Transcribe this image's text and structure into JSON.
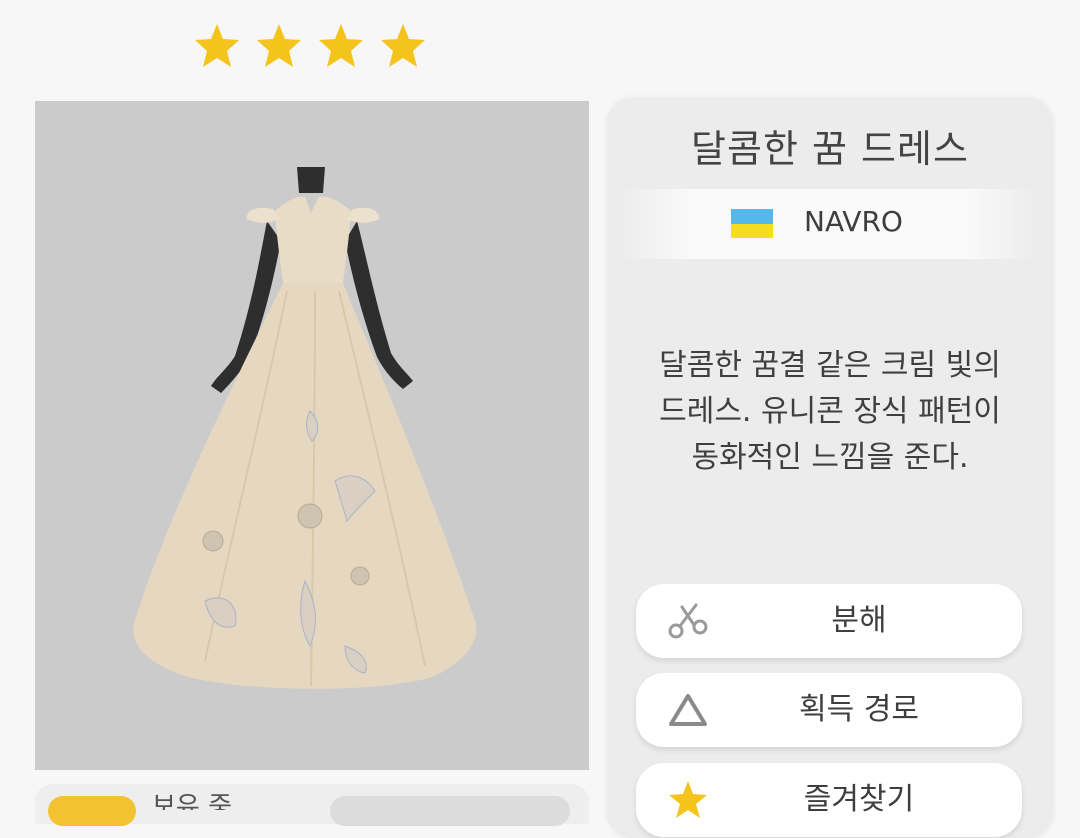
{
  "rating": {
    "stars": 4,
    "star_color": "#f4c41c"
  },
  "item": {
    "title": "달콤한 꿈 드레스",
    "brand": "NAVRO",
    "flag_colors": [
      "#55b8e8",
      "#f5dc1e"
    ],
    "description_lines": [
      "달콤한 꿈결 같은 크림 빛의",
      "드레스. 유니콘 장식 패턴이",
      "동화적인 느낌을 준다."
    ]
  },
  "actions": {
    "dismantle": {
      "label": "분해",
      "icon": "scissors-icon"
    },
    "source": {
      "label": "획득 경로",
      "icon": "triangle-icon"
    },
    "favorite": {
      "label": "즐겨찾기",
      "icon": "star-icon"
    }
  },
  "footer": {
    "owned_label": "보유 중"
  },
  "colors": {
    "panel_bg": "#cbcbcb",
    "dress": "#e6d8c0",
    "accent": "#f2c230"
  }
}
